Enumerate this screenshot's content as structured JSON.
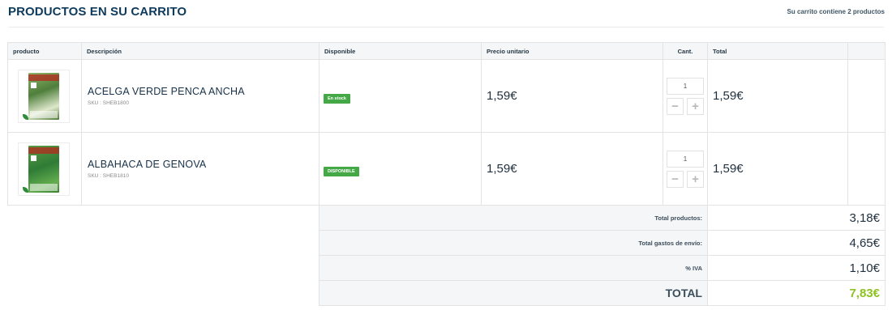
{
  "header": {
    "title": "PRODUCTOS EN SU CARRITO",
    "cart_count": "Su carrito contiene 2 productos"
  },
  "table": {
    "columns": [
      "producto",
      "Descripción",
      "Disponible",
      "Precio unitario",
      "Cant.",
      "Total",
      ""
    ],
    "rows": [
      {
        "name": "ACELGA VERDE PENCA ANCHA",
        "sku": "SKU : SHEB1800",
        "availability": "En stock",
        "unit_price": "1,59€",
        "quantity": "1",
        "total": "1,59€"
      },
      {
        "name": "ALBAHACA DE GENOVA",
        "sku": "SKU : SHEB1810",
        "availability": "DISPONIBLE",
        "unit_price": "1,59€",
        "quantity": "1",
        "total": "1,59€"
      }
    ],
    "qty_minus": "−",
    "qty_plus": "+"
  },
  "totals": {
    "products_label": "Total productos:",
    "products_value": "3,18€",
    "shipping_label": "Total gastos de envío:",
    "shipping_value": "4,65€",
    "vat_label": "% IVA",
    "vat_value": "1,10€",
    "grand_label": "TOTAL",
    "grand_value": "7,83€"
  },
  "colors": {
    "title": "#0e3a5c",
    "badge": "#45a847",
    "grand_total": "#8dc21f"
  }
}
